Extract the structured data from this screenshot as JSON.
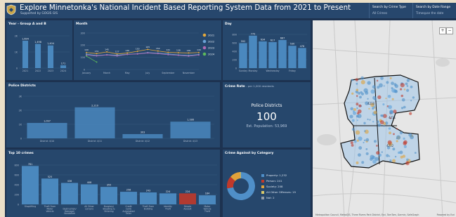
{
  "header": {
    "title": "Explore Minnetonka's National Incident Based Reporting System Data from 2021 to Present",
    "subtitle": "Supported by GOGIS GIS",
    "crime_type": {
      "label": "Search by Crime Type",
      "value": "All Crimes"
    },
    "date_range": {
      "label": "Search by Date Range",
      "value": "Timespan the date"
    }
  },
  "panels": {
    "year": "Year - Group A and B",
    "month": "Month",
    "day": "Day",
    "districts": "Police Districts",
    "rate": "Crime Rate",
    "rate_note": "- per 1,000 residents",
    "top10": "Top 10 crimes",
    "against": "Crime Against by Category"
  },
  "kpi": {
    "caption": "Police Districts",
    "value": "100",
    "sub": "Est. Population: 53,969"
  },
  "map": {
    "attribution": "Metropolitan Council, MetroGIS, Three Rivers Park District, Esri, TomTom, Garmin, SafeGraph",
    "powered": "Powered by Esri"
  },
  "colors": {
    "accent": "#4f8fc8",
    "danger": "#c0392b",
    "panel": "#26476c"
  },
  "chart_data": [
    {
      "type": "bar",
      "title": "Year - Group A and B",
      "categories": [
        "2021",
        "2022",
        "2023",
        "2024"
      ],
      "values": [
        1694,
        1498,
        1404,
        171
      ],
      "labels": [
        "1,694",
        "1,498",
        "1,404",
        "171"
      ],
      "yticks": [
        "2K",
        "1K",
        "0"
      ],
      "ylim": [
        0,
        2000
      ]
    },
    {
      "type": "line",
      "title": "Month",
      "categories": [
        "January",
        "February",
        "March",
        "April",
        "May",
        "June",
        "July",
        "August",
        "September",
        "October",
        "November",
        "December"
      ],
      "tick_labels": [
        "January",
        "March",
        "May",
        "July",
        "September",
        "November"
      ],
      "yticks": [
        "300",
        "200",
        "100",
        "0"
      ],
      "ylim": [
        0,
        300
      ],
      "series": [
        {
          "name": "2021",
          "color": "#e3a83c",
          "values": [
            140,
            131,
            145,
            128,
            136,
            150,
            165,
            152,
            141,
            138,
            136,
            140
          ]
        },
        {
          "name": "2022",
          "color": "#6ba3d6",
          "values": [
            127,
            115,
            122,
            118,
            125,
            130,
            139,
            135,
            128,
            120,
            116,
            124
          ]
        },
        {
          "name": "2023",
          "color": "#b06ab3",
          "values": [
            118,
            112,
            120,
            111,
            124,
            128,
            136,
            131,
            122,
            117,
            110,
            119
          ]
        },
        {
          "name": "2024",
          "color": "#5cb85c",
          "values": [
            110,
            61,
            0,
            0,
            0,
            0,
            0,
            0,
            0,
            0,
            0,
            0
          ]
        }
      ],
      "point_labels": [
        "140",
        "131",
        "145",
        "127",
        "136",
        "150",
        "165",
        "152",
        "141",
        "138",
        "136",
        "140"
      ]
    },
    {
      "type": "bar",
      "title": "Day",
      "categories": [
        "Sunday",
        "Monday",
        "Tuesday",
        "Wednesday",
        "Thursday",
        "Friday",
        "Saturday"
      ],
      "tick_labels": [
        "Monday",
        "Wednesday",
        "Friday",
        "Sunday"
      ],
      "values": [
        592,
        770,
        634,
        617,
        667,
        530,
        478
      ],
      "labels": [
        "592",
        "770",
        "634",
        "617",
        "667",
        "530",
        "478"
      ],
      "yticks": [
        "800",
        "600",
        "400",
        "200",
        "0"
      ],
      "ylim": [
        0,
        800
      ]
    },
    {
      "type": "bar",
      "title": "Police Districts",
      "categories": [
        "District 4/10",
        "District 4/11",
        "District 4/12",
        "District 4/13"
      ],
      "values": [
        1097,
        2210,
        303,
        1188
      ],
      "labels": [
        "1,097",
        "2,210",
        "303",
        "1,188"
      ],
      "yticks": [
        "3K",
        "2K",
        "1K",
        "0"
      ],
      "ylim": [
        0,
        3000
      ]
    },
    {
      "type": "bar",
      "title": "Top 10 crimes",
      "categories": [
        "Shoplifting",
        "Theft From Motor Vehicle",
        "Destruction/ Damage/ Vandalism",
        "All Other Larceny",
        "Burglary/ Breaking & Entering",
        "Credit Card/ Automated Teller",
        "Theft From Building",
        "Identity Theft",
        "Simple Assault",
        "Motor Vehicle Theft"
      ],
      "values": [
        781,
        525,
        436,
        408,
        355,
        256,
        243,
        224,
        224,
        184
      ],
      "labels": [
        "781",
        "525",
        "436",
        "408",
        "355",
        "256",
        "243",
        "224",
        "224",
        "184"
      ],
      "highlight_index": 8,
      "yticks": [
        "800",
        "600",
        "400",
        "200",
        "0"
      ],
      "ylim": [
        0,
        800
      ]
    },
    {
      "type": "pie",
      "title": "Crime Against by Category",
      "categories": [
        "Property",
        "Person",
        "Society",
        "All Other Offenses",
        "Not"
      ],
      "values": [
        1232,
        241,
        208,
        19,
        2
      ],
      "labels": [
        "Property: 1,232",
        "Person: 241",
        "Society: 208",
        "All Other Offenses: 19",
        "Not: 2"
      ],
      "colors": [
        "#4f8fc8",
        "#c0392b",
        "#e0a23a",
        "#d8c96a",
        "#8e9aa8"
      ]
    }
  ]
}
